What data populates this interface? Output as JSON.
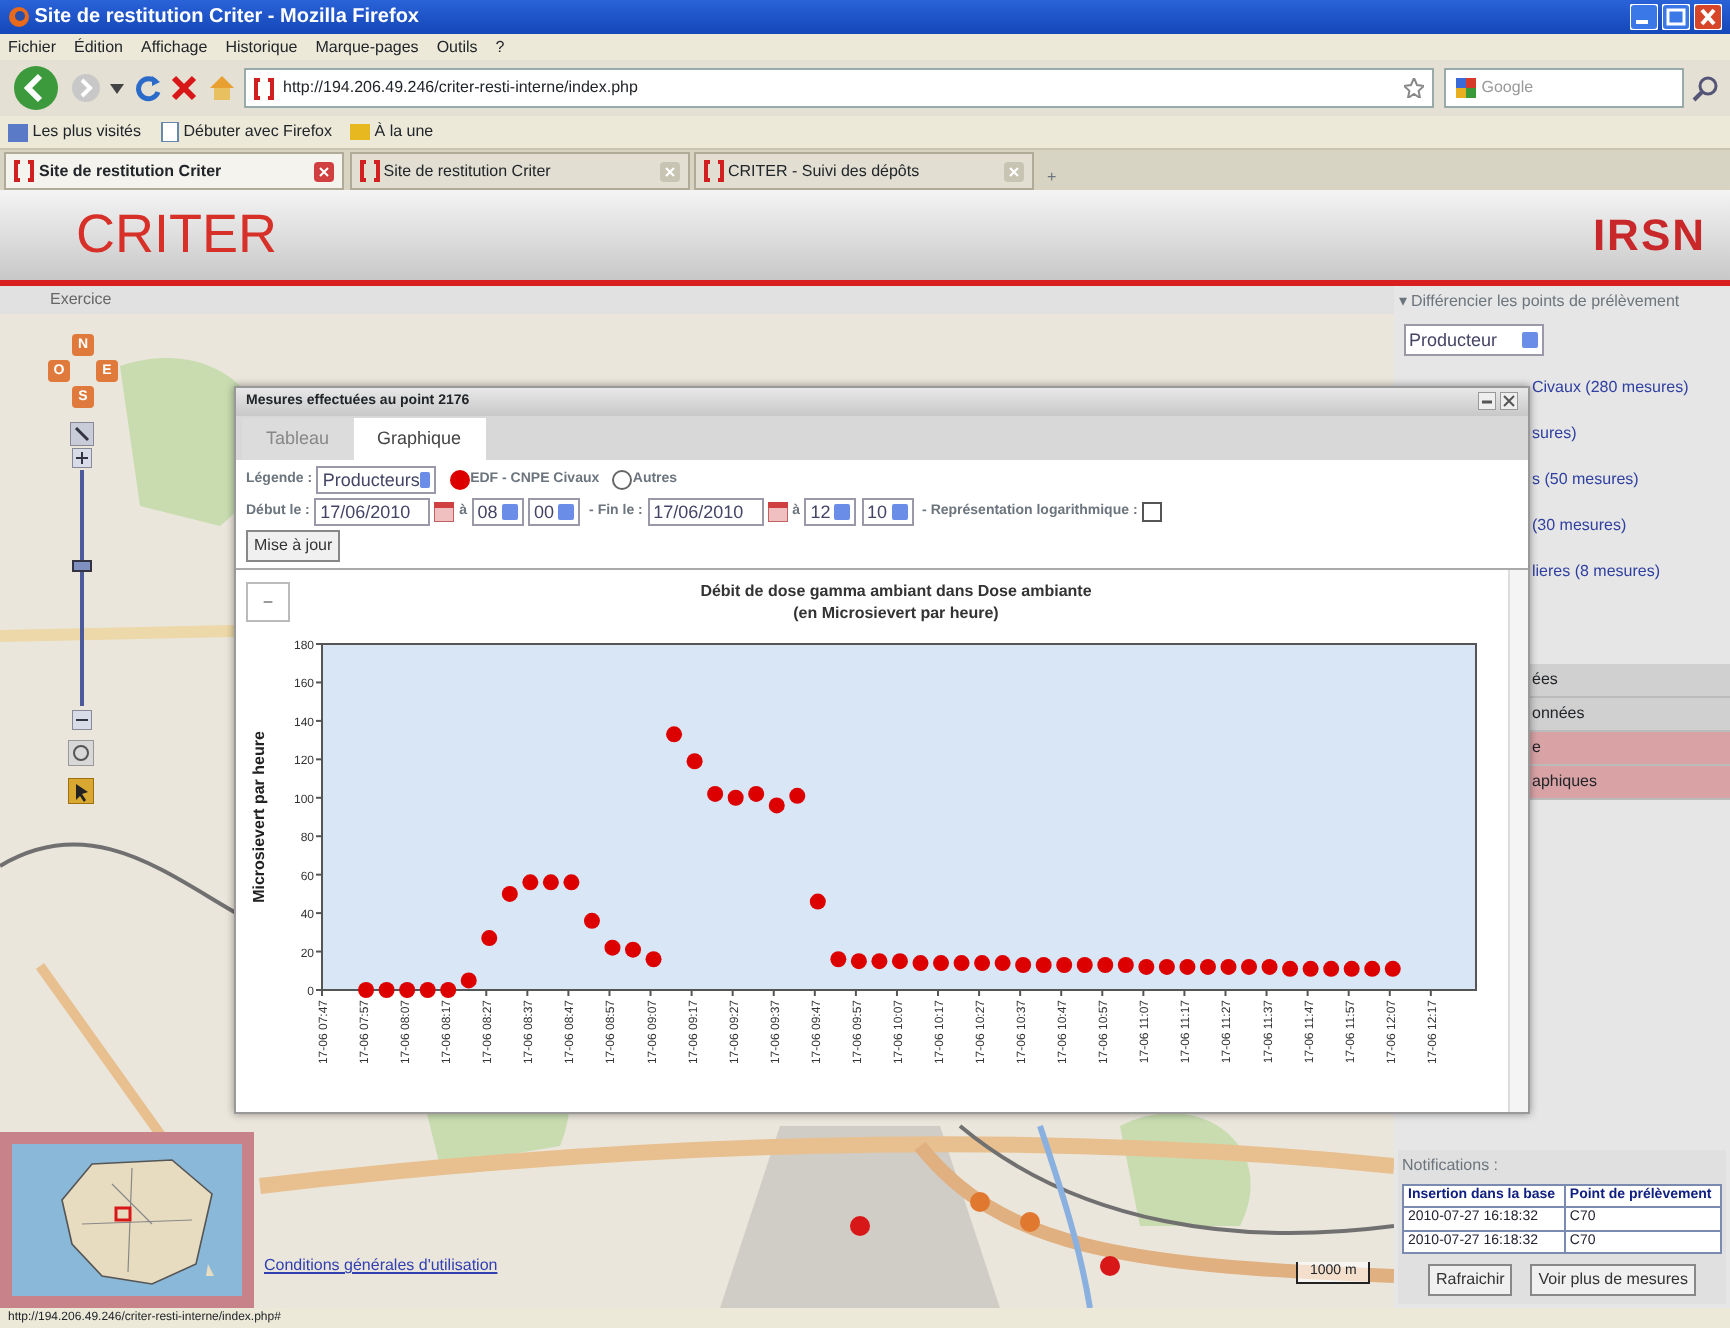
{
  "browser": {
    "title": "Site de restitution Criter - Mozilla Firefox",
    "menu": [
      "Fichier",
      "Édition",
      "Affichage",
      "Historique",
      "Marque-pages",
      "Outils",
      "?"
    ],
    "url": "http://194.206.49.246/criter-resti-interne/index.php",
    "search_placeholder": "Google",
    "bookmarks": [
      "Les plus visités",
      "Débuter avec Firefox",
      "À la une"
    ],
    "tabs": [
      {
        "label": "Site de restitution Criter",
        "selected": true
      },
      {
        "label": "Site de restitution Criter",
        "selected": false
      },
      {
        "label": "CRITER - Suivi des dépôts",
        "selected": false
      }
    ],
    "new_tab": "+",
    "status": "http://194.206.49.246/criter-resti-interne/index.php#"
  },
  "header": {
    "title": "CRITER",
    "logo": "IRSN"
  },
  "map": {
    "section_label": "Exercice",
    "pan_buttons": [
      "N",
      "O",
      "E",
      "S"
    ],
    "zoom": {
      "level": 0.6
    },
    "terms_link": "Conditions générales d'utilisation",
    "scale": "1000 m"
  },
  "dialog": {
    "title": "Mesures effectuées au point 2176",
    "tabs": [
      {
        "label": "Tableau",
        "selected": false
      },
      {
        "label": "Graphique",
        "selected": true
      }
    ],
    "legend_label": "Légende :",
    "legend_select": "Producteurs",
    "legend_options": [
      {
        "label": "EDF - CNPE Civaux",
        "selected": true,
        "color": "#dd0000"
      },
      {
        "label": "Autres",
        "selected": false
      }
    ],
    "start_label": "Début le :",
    "start_date": "17/06/2010",
    "start_at": "à",
    "start_hour": "08",
    "start_min": "00",
    "end_label": "- Fin le :",
    "end_date": "17/06/2010",
    "end_at": "à",
    "end_hour": "12",
    "end_min": "10",
    "log_label": "- Représentation logarithmique :",
    "log_checked": false,
    "update_button": "Mise à jour",
    "collapse_button": "−",
    "chart_subtitle": "(en Microsievert par heure)",
    "chart_data": {
      "type": "scatter",
      "title": "Débit de dose gamma ambiant dans Dose ambiante",
      "ylabel": "Microsievert par heure",
      "ylim": [
        0,
        180
      ],
      "yticks": [
        0,
        20,
        40,
        60,
        80,
        100,
        120,
        140,
        160,
        180
      ],
      "categories": [
        "17-06 07:47",
        null,
        "17-06 07:57",
        null,
        "17-06 08:07",
        null,
        "17-06 08:17",
        null,
        "17-06 08:27",
        null,
        "17-06 08:37",
        null,
        "17-06 08:47",
        null,
        "17-06 08:57",
        null,
        "17-06 09:07",
        null,
        "17-06 09:17",
        null,
        "17-06 09:27",
        null,
        "17-06 09:37",
        null,
        "17-06 09:47",
        null,
        "17-06 09:57",
        null,
        "17-06 10:07",
        null,
        "17-06 10:17",
        null,
        "17-06 10:27",
        null,
        "17-06 10:37",
        null,
        "17-06 10:47",
        null,
        "17-06 10:57",
        null,
        "17-06 11:07",
        null,
        "17-06 11:17",
        null,
        "17-06 11:27",
        null,
        "17-06 11:37",
        null,
        "17-06 11:47",
        null,
        "17-06 11:57",
        null,
        "17-06 12:07",
        null,
        "17-06 12:17"
      ],
      "series": [
        {
          "color": "#dd0000",
          "values": [
            null,
            null,
            0,
            0,
            0,
            0,
            0,
            5,
            27,
            50,
            56,
            56,
            56,
            36,
            22,
            21,
            16,
            133,
            119,
            102,
            100,
            102,
            96,
            101,
            46,
            16,
            15,
            15,
            15,
            14,
            14,
            14,
            14,
            14,
            13,
            13,
            13,
            13,
            13,
            13,
            12,
            12,
            12,
            12,
            12,
            12,
            12,
            11,
            11,
            11,
            11,
            11,
            11,
            null,
            null
          ]
        }
      ]
    }
  },
  "right_panel": {
    "heading": "▾ Différencier les points de prélèvement",
    "select": "Producteur",
    "links": [
      "Civaux (280 mesures)",
      "sures)",
      "s (50 mesures)",
      "(30 mesures)",
      "lieres (8 mesures)"
    ],
    "sections": [
      {
        "label": "ées",
        "selected": false
      },
      {
        "label": "onnées",
        "selected": false
      },
      {
        "label": "e",
        "selected": true
      },
      {
        "label": "aphiques",
        "selected": true
      }
    ]
  },
  "notifications": {
    "title": "Notifications :",
    "columns": [
      "Insertion dans la base",
      "Point de prélèvement"
    ],
    "rows": [
      [
        "2010-07-27 16:18:32",
        "C70"
      ],
      [
        "2010-07-27 16:18:32",
        "C70"
      ]
    ],
    "buttons": [
      "Rafraichir",
      "Voir plus de mesures"
    ]
  }
}
